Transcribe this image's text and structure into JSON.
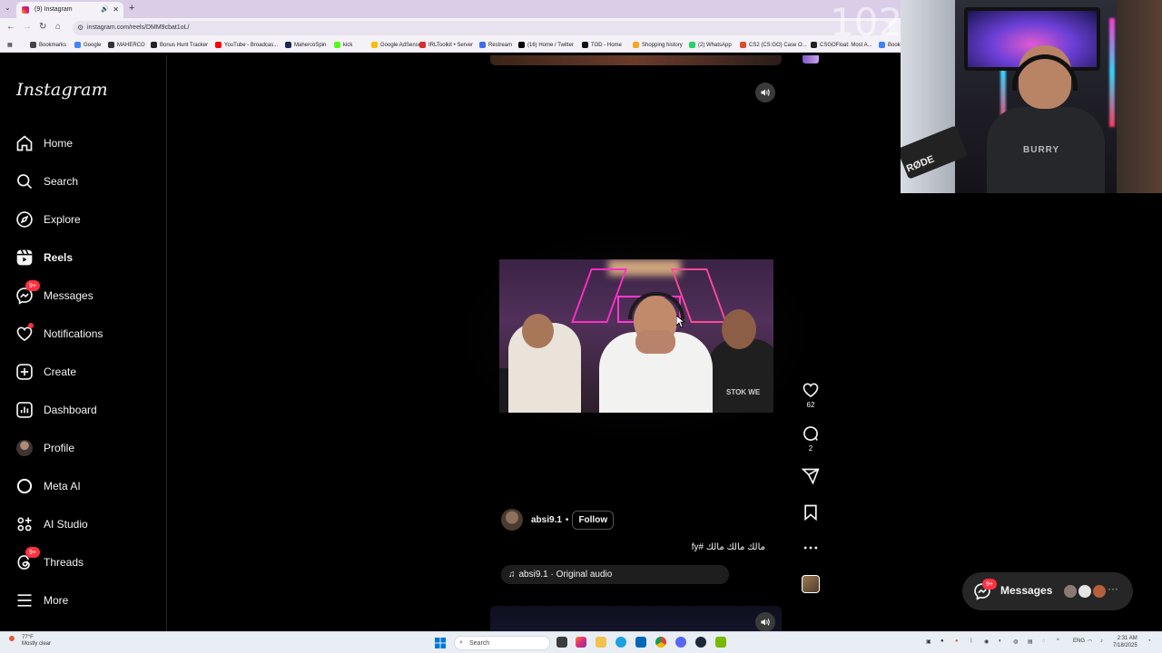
{
  "browser": {
    "tab_title": "(9) Instagram",
    "url": "instagram.com/reels/DMM9cbat1oL/",
    "bookmarks": [
      {
        "label": "Bookmarks",
        "color": "#444"
      },
      {
        "label": "Google",
        "color": "#4285f4"
      },
      {
        "label": "MAHERCO",
        "color": "#333"
      },
      {
        "label": "Bonus Hunt Tracker",
        "color": "#222"
      },
      {
        "label": "YouTube - Broadcas...",
        "color": "#ff0000"
      },
      {
        "label": "MahercoSpin",
        "color": "#1a2a55"
      },
      {
        "label": "kick",
        "color": "#53fc18"
      },
      {
        "label": "Google AdSense",
        "color": "#fbbc04"
      },
      {
        "label": "IRLToolkit • Server",
        "color": "#d62f2f"
      },
      {
        "label": "Restream",
        "color": "#3b6df0"
      },
      {
        "label": "(16) Home / Twitter",
        "color": "#000"
      },
      {
        "label": "TOD - Home",
        "color": "#111"
      },
      {
        "label": "Shopping history",
        "color": "#f5a623"
      },
      {
        "label": "(2) WhatsApp",
        "color": "#25d366"
      },
      {
        "label": "CS2 (CS:GO) Case O...",
        "color": "#d94e2a"
      },
      {
        "label": "CSGOFloat: Most A...",
        "color": "#222"
      },
      {
        "label": "Book",
        "color": "#3b82f6"
      }
    ]
  },
  "overlay": {
    "channel_number": "102"
  },
  "sidebar": {
    "logo": "Instagram",
    "items": [
      {
        "label": "Home",
        "icon": "home-icon"
      },
      {
        "label": "Search",
        "icon": "search-icon"
      },
      {
        "label": "Explore",
        "icon": "explore-icon"
      },
      {
        "label": "Reels",
        "icon": "reels-icon",
        "active": true
      },
      {
        "label": "Messages",
        "icon": "messenger-icon",
        "badge": "9+"
      },
      {
        "label": "Notifications",
        "icon": "heart-icon",
        "dot": true
      },
      {
        "label": "Create",
        "icon": "plus-square-icon"
      },
      {
        "label": "Dashboard",
        "icon": "dashboard-icon"
      },
      {
        "label": "Profile",
        "icon": "avatar"
      },
      {
        "label": "Meta AI",
        "icon": "meta-ai-icon"
      },
      {
        "label": "AI Studio",
        "icon": "ai-studio-icon"
      },
      {
        "label": "Threads",
        "icon": "threads-icon",
        "badge": "9+"
      },
      {
        "label": "More",
        "icon": "hamburger-icon"
      }
    ]
  },
  "reel": {
    "username": "absi9.1",
    "separator": "•",
    "follow_label": "Follow",
    "caption": "مالك مالك مالك #fy",
    "audio": "absi9.1 · Original audio",
    "video_overlay_text": "STOK WE",
    "likes": "62",
    "comments": "2"
  },
  "messages_pill": {
    "label": "Messages",
    "badge": "9+",
    "more": "···"
  },
  "webcam": {
    "mic_brand": "RØDE",
    "shirt_text": "BURRY"
  },
  "taskbar": {
    "weather_temp": "77°F",
    "weather_desc": "Mostly clear",
    "search_placeholder": "Search",
    "lang": "ENG",
    "time": "2:31 AM",
    "date": "7/18/2025"
  }
}
